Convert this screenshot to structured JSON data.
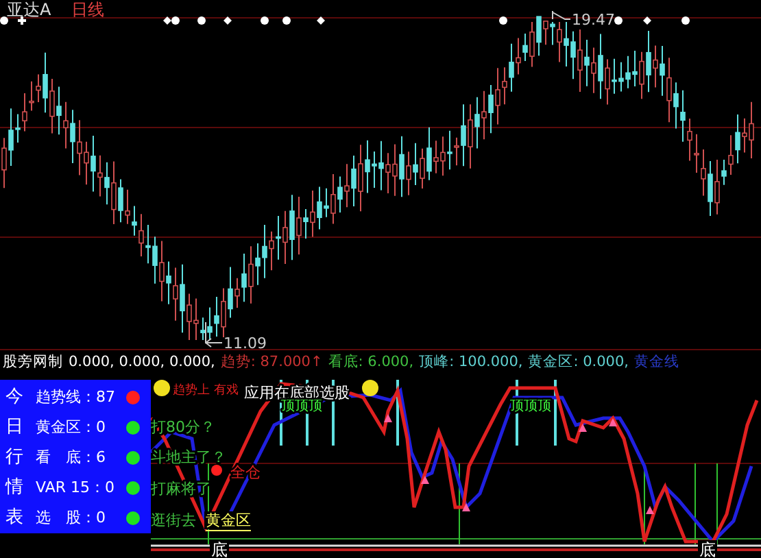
{
  "title": {
    "stock": "亚达A",
    "period": "日线"
  },
  "price_labels": {
    "high": "19.47",
    "low": "11.09"
  },
  "indicator_header": {
    "name": "股旁网制",
    "values": "0.000, 0.000, 0.000,",
    "items": [
      {
        "text": "趋势: 87.000↑",
        "color": "#c83232"
      },
      {
        "text": "看底: 6.000,",
        "color": "#40c040"
      },
      {
        "text": "顶峰: 100.000,",
        "color": "#60d0d0"
      },
      {
        "text": "黄金区: 0.000,",
        "color": "#60d0d0"
      },
      {
        "text": "黄金线",
        "color": "#2a3ccc"
      }
    ]
  },
  "info_panel": {
    "rows": [
      {
        "side": "今",
        "label": "趋势线：87",
        "color": "#ff2020"
      },
      {
        "side": "日",
        "label": "黄金区：0",
        "color": "#20e020"
      },
      {
        "side": "行",
        "label": "看　底：6",
        "color": "#20e020"
      },
      {
        "side": "情",
        "label": "VAR 15：0",
        "color": "#20e020"
      },
      {
        "side": "表",
        "label": "选　股：0",
        "color": "#20e020"
      }
    ]
  },
  "chart_labels": [
    {
      "text": "趋势上 有戏",
      "color": "#e02020"
    },
    {
      "text": "应用在底部选股",
      "color": "#ffffff"
    },
    {
      "text": "顶顶顶",
      "color": "#40ff40"
    },
    {
      "text": "顶顶顶",
      "color": "#40ff40"
    },
    {
      "text": "打80分？",
      "color": "#40c040"
    },
    {
      "text": "斗地主了？",
      "color": "#40c040"
    },
    {
      "text": "全仓",
      "color": "#e02020"
    },
    {
      "text": "打麻将了",
      "color": "#40c040"
    },
    {
      "text": "逛街去",
      "color": "#40c040"
    },
    {
      "text": "黄金区",
      "color": "#ffff60"
    },
    {
      "text": "底",
      "color": "#ffffff"
    },
    {
      "text": "底",
      "color": "#ffffff"
    }
  ]
}
